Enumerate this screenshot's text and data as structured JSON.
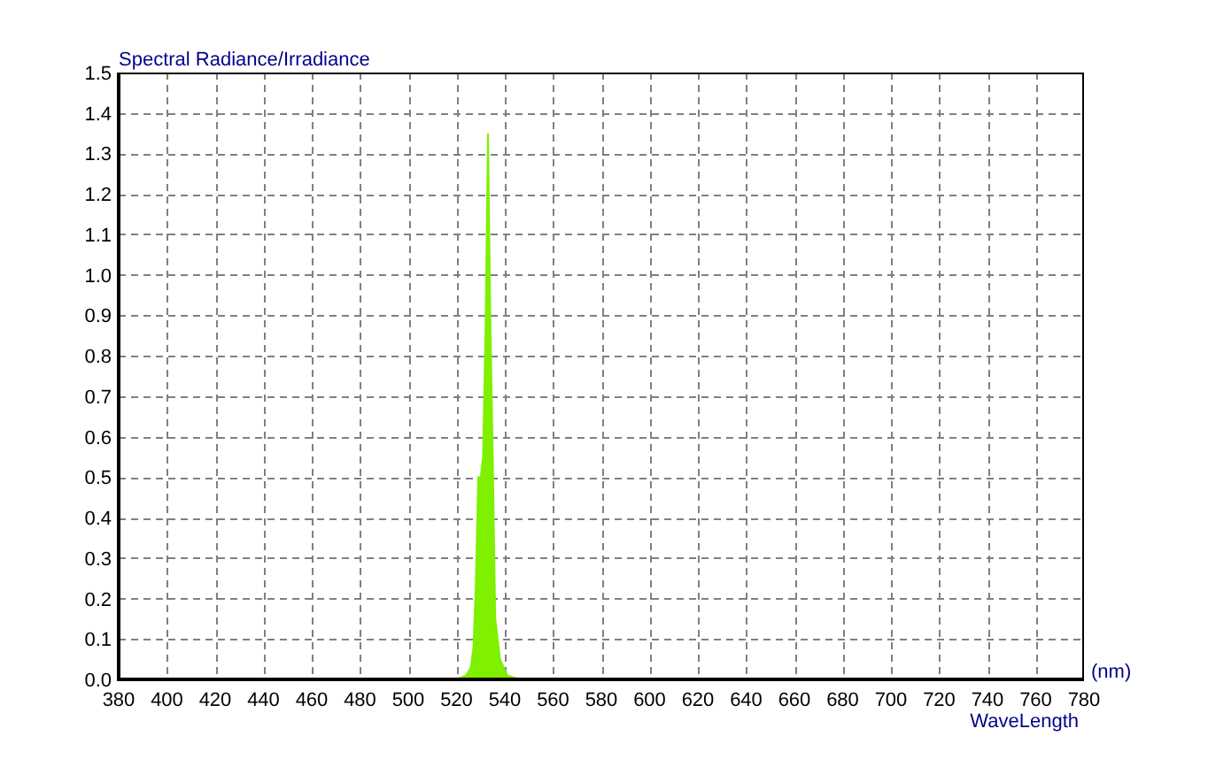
{
  "chart": {
    "unit_label": "(nm)",
    "chart_data": {
      "type": "area",
      "ylabel": "Spectral Radiance/Irradiance",
      "xlabel": "WaveLength",
      "x": [
        520,
        524,
        526,
        527,
        528,
        529,
        530,
        531,
        532,
        533,
        534,
        535,
        536,
        538,
        541,
        546
      ],
      "grid": true,
      "series": [
        {
          "color": "#7ef000",
          "values": [
            0,
            0.01,
            0.03,
            0.08,
            0.23,
            0.5,
            0.5,
            0.55,
            0.86,
            1.35,
            0.9,
            0.55,
            0.15,
            0.05,
            0.01,
            0
          ]
        }
      ],
      "xlim": [
        380,
        780
      ],
      "ylim": [
        0,
        1.5
      ],
      "xticks": [
        380,
        400,
        420,
        440,
        460,
        480,
        500,
        520,
        540,
        560,
        580,
        600,
        620,
        640,
        660,
        680,
        700,
        720,
        740,
        760,
        780
      ],
      "yticks": [
        {
          "value": 0,
          "label": "0.0"
        },
        {
          "value": 0.1,
          "label": "0.1"
        },
        {
          "value": 0.2,
          "label": "0.2"
        },
        {
          "value": 0.3,
          "label": "0.3"
        },
        {
          "value": 0.4,
          "label": "0.4"
        },
        {
          "value": 0.5,
          "label": "0.5"
        },
        {
          "value": 0.6,
          "label": "0.6"
        },
        {
          "value": 0.7,
          "label": "0.7"
        },
        {
          "value": 0.8,
          "label": "0.8"
        },
        {
          "value": 0.9,
          "label": "0.9"
        },
        {
          "value": 1,
          "label": "1.0"
        },
        {
          "value": 1.1,
          "label": "1.1"
        },
        {
          "value": 1.2,
          "label": "1.2"
        },
        {
          "value": 1.3,
          "label": "1.3"
        },
        {
          "value": 1.4,
          "label": "1.4"
        },
        {
          "value": 1.5,
          "label": "1.5"
        }
      ]
    }
  }
}
